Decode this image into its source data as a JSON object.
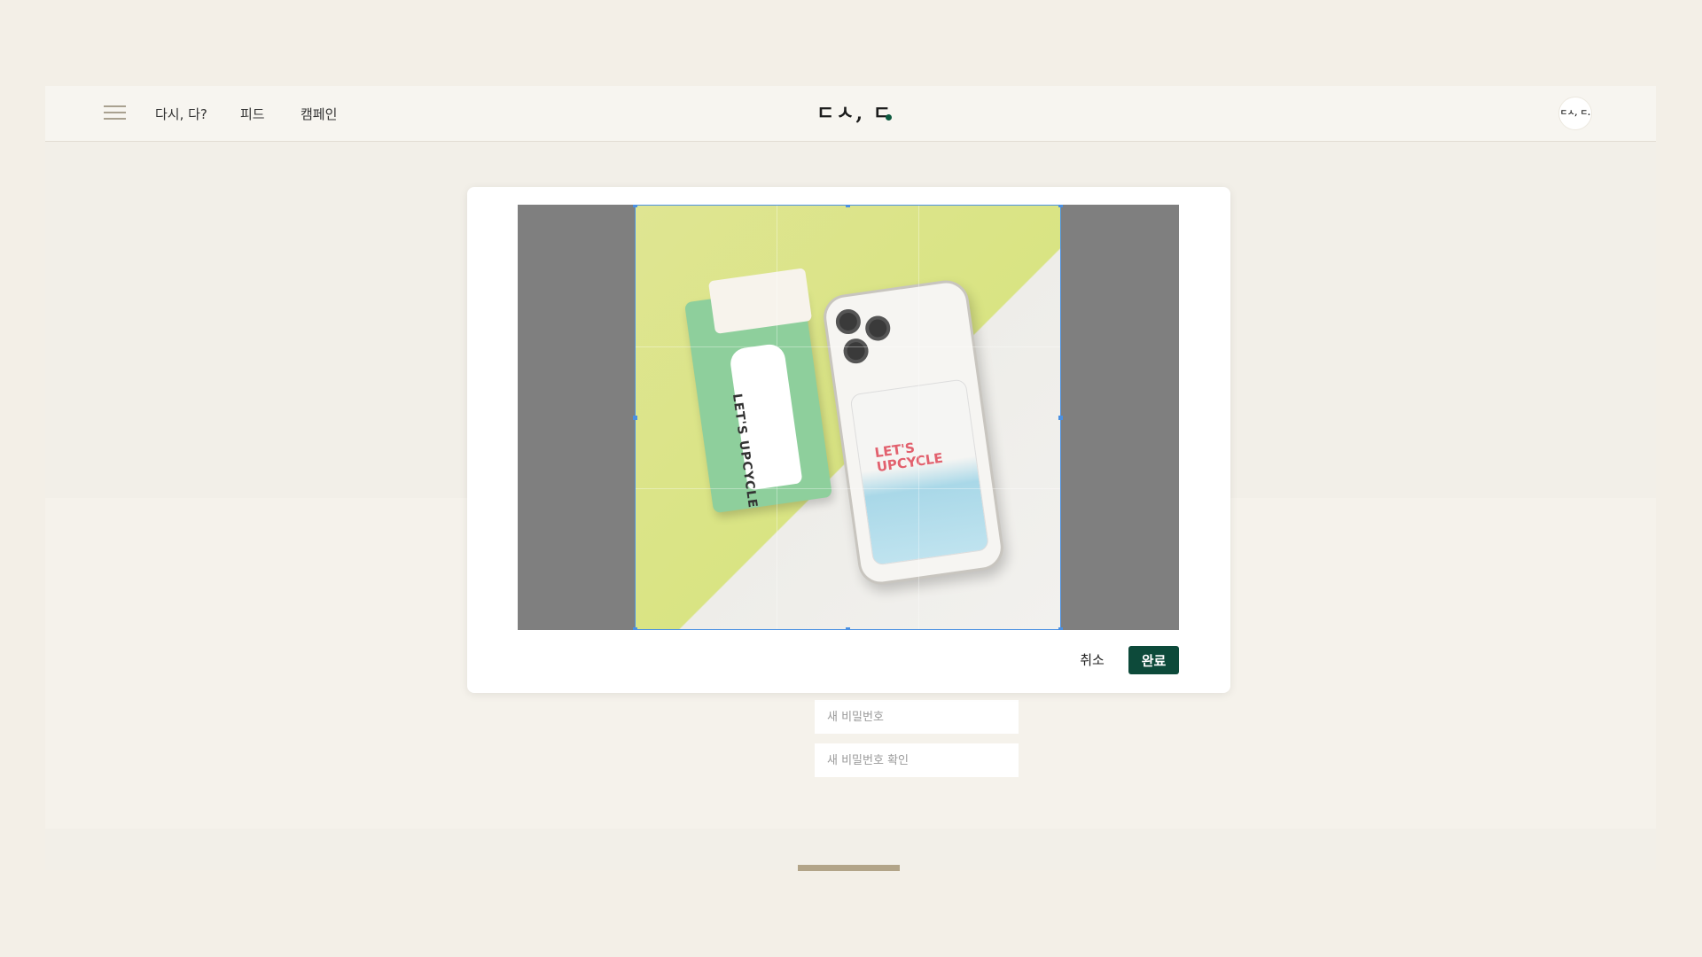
{
  "header": {
    "nav": [
      {
        "label": "다시, 다?"
      },
      {
        "label": "피드"
      },
      {
        "label": "캠페인"
      }
    ],
    "logo_text": "ㄷㅅ, ㄷ",
    "avatar_text": "ㄷㅅ, ㄷ.",
    "accent_color": "#0e5a3f"
  },
  "form": {
    "new_password_placeholder": "새 비밀번호",
    "confirm_password_placeholder": "새 비밀번호 확인"
  },
  "crop_modal": {
    "image": {
      "subject": "upcycled card wallet and phone case",
      "card_text": "LET'S UPCYCLE",
      "phone_text": "LET'S UPCYCLE"
    },
    "cancel_label": "취소",
    "done_label": "완료",
    "done_color": "#0d4a3a",
    "crop_frame_color": "#4a90e2"
  }
}
